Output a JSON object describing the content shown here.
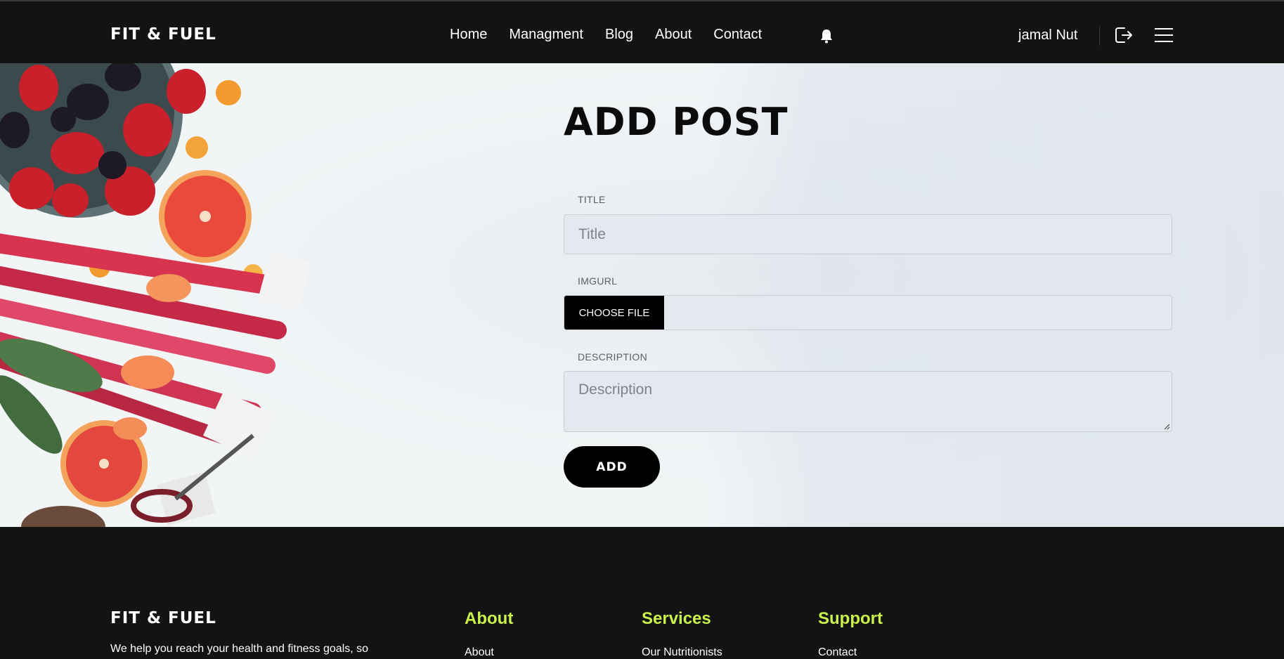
{
  "brand": {
    "name": "FIT & FUEL"
  },
  "nav": {
    "items": [
      "Home",
      "Managment",
      "Blog",
      "About",
      "Contact"
    ]
  },
  "header": {
    "user_name": "jamal Nut",
    "icons": [
      "bell-icon",
      "logout-icon",
      "menu-icon"
    ]
  },
  "form": {
    "title": "ADD POST",
    "title_label": "TITLE",
    "title_placeholder": "Title",
    "img_label": "IMGURL",
    "choose_file": "CHOOSE FILE",
    "description_label": "DESCRIPTION",
    "description_placeholder": "Description",
    "submit": "ADD"
  },
  "footer": {
    "brand": "FIT & FUEL",
    "tagline": "We help you reach your health and fitness goals, so",
    "columns": [
      {
        "heading": "About",
        "first_link": "About"
      },
      {
        "heading": "Services",
        "first_link": "Our Nutritionists"
      },
      {
        "heading": "Support",
        "first_link": "Contact"
      }
    ],
    "accent": "#c9f24b"
  }
}
